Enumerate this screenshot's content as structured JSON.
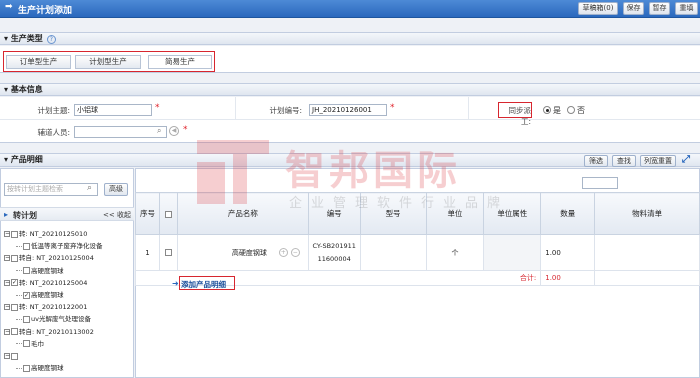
{
  "window": {
    "title": "生产计划添加"
  },
  "toolbar": {
    "draft_label": "草稿箱(0)",
    "save_label": "保存",
    "temp_save_label": "暂存",
    "reset_label": "重填"
  },
  "production_type": {
    "header": "生产类型",
    "tabs": [
      {
        "label": "订单型生产"
      },
      {
        "label": "计划型生产"
      },
      {
        "label": "简易生产"
      }
    ]
  },
  "basic_info": {
    "header": "基本信息",
    "plan_subject_label": "计划主题:",
    "plan_subject_value": "小铝球",
    "plan_no_label": "计划编号:",
    "plan_no_value": "JH_20210126001",
    "sync_label": "同步派工:",
    "sync_yes": "是",
    "sync_no": "否",
    "assignee_label": "辅道人员:"
  },
  "product_detail": {
    "header": "产品明细",
    "filter_label": "筛选",
    "find_label": "查找",
    "column_reset_label": "列宽重置",
    "search_placeholder": "按转计划主题检索",
    "advanced_label": "高级",
    "tree_title": "转计划",
    "collapse_label": "<< 收起",
    "add_product_label": "添加产品明细"
  },
  "tree": [
    {
      "text": "转: NT_20210125010",
      "checked": false
    },
    {
      "text": "低温等离子废弃净化设备",
      "checked": false
    },
    {
      "text": "转自: NT_20210125004",
      "checked": false
    },
    {
      "text": "高硬度钢球",
      "checked": false
    },
    {
      "text": "转: NT_20210125004",
      "checked": true
    },
    {
      "text": "高硬度钢球",
      "checked": true
    },
    {
      "text": "转: NT_20210122001",
      "checked": false
    },
    {
      "text": "uv光解废气处理设备",
      "checked": false
    },
    {
      "text": "转自: NT_20210113002",
      "checked": false
    },
    {
      "text": "毛巾",
      "checked": false
    },
    {
      "text": "",
      "checked": false
    },
    {
      "text": "高硬度钢球",
      "checked": false
    }
  ],
  "table": {
    "headers": {
      "seq": "序号",
      "name": "产品名称",
      "code": "编号",
      "model": "型号",
      "unit": "单位",
      "unit_attr": "单位属性",
      "qty": "数量",
      "bom": "物料清单"
    },
    "rows": [
      {
        "seq": "1",
        "name": "高硬度钢球",
        "code": "CY-SB20191111600004",
        "model": "",
        "unit": "个",
        "unit_attr": "",
        "qty": "1.00"
      }
    ],
    "total_label": "合计:",
    "total_value": "1.00"
  },
  "watermark": {
    "big": "智邦国际",
    "small": "企业管理软件行业品牌"
  },
  "colors": {
    "accent": "#2a68bd",
    "red": "#d7262f"
  }
}
